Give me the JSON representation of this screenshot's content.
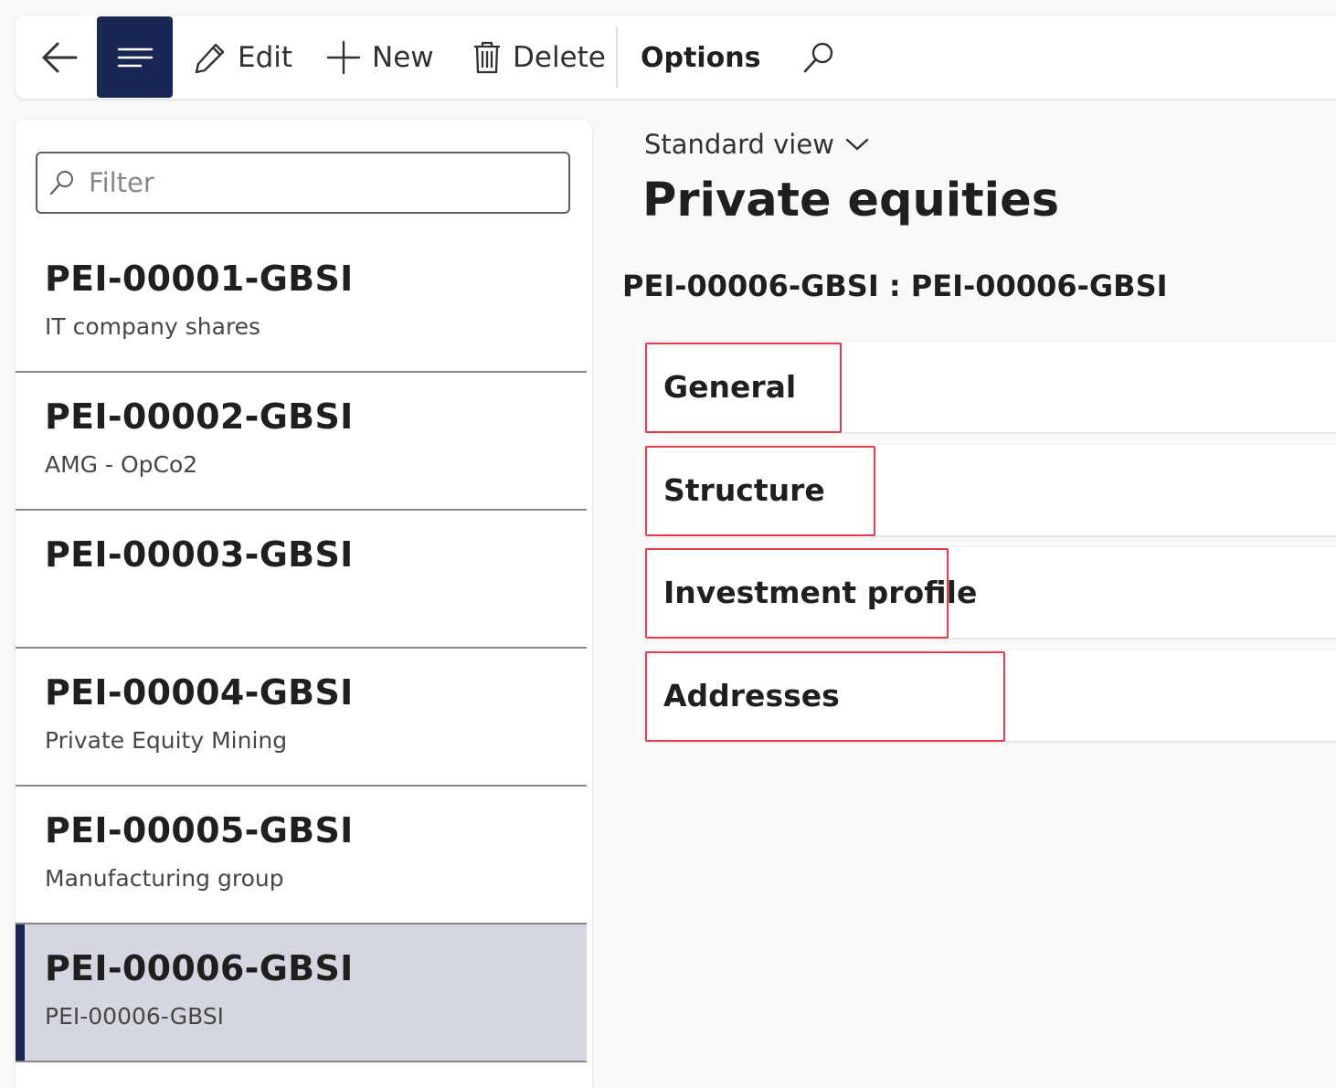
{
  "toolbar": {
    "back_icon": "back-arrow-icon",
    "menu_icon": "menu-lines-icon",
    "edit_label": "Edit",
    "new_label": "New",
    "delete_label": "Delete",
    "options_label": "Options",
    "search_icon": "search-icon",
    "accent_color": "#182653"
  },
  "filter": {
    "placeholder": "Filter",
    "value": ""
  },
  "list": {
    "items": [
      {
        "id": "PEI-00001-GBSI",
        "description": "IT company shares"
      },
      {
        "id": "PEI-00002-GBSI",
        "description": "AMG - OpCo2"
      },
      {
        "id": "PEI-00003-GBSI",
        "description": ""
      },
      {
        "id": "PEI-00004-GBSI",
        "description": "Private Equity Mining"
      },
      {
        "id": "PEI-00005-GBSI",
        "description": "Manufacturing group"
      },
      {
        "id": "PEI-00006-GBSI",
        "description": "PEI-00006-GBSI"
      }
    ],
    "selected_id": "PEI-00006-GBSI"
  },
  "main": {
    "view_label": "Standard view",
    "page_title": "Private equities",
    "record_title": "PEI-00006-GBSI : PEI-00006-GBSI",
    "sections": [
      {
        "label": "General"
      },
      {
        "label": "Structure"
      },
      {
        "label": "Investment profile"
      },
      {
        "label": "Addresses"
      }
    ],
    "highlight_color": "#e53b4b"
  }
}
